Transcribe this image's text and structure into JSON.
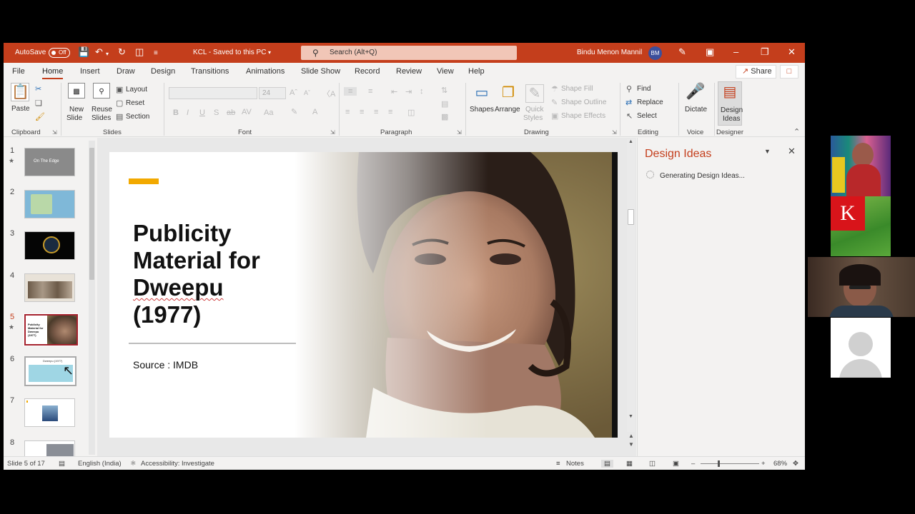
{
  "titlebar": {
    "autosave_label": "AutoSave",
    "autosave_state": "Off",
    "doc_title": "KCL  -  Saved to this PC",
    "search_placeholder": "Search (Alt+Q)",
    "user_name": "Bindu Menon Mannil",
    "user_initials": "BM"
  },
  "tabs": [
    "File",
    "Home",
    "Insert",
    "Draw",
    "Design",
    "Transitions",
    "Animations",
    "Slide Show",
    "Record",
    "Review",
    "View",
    "Help"
  ],
  "active_tab": "Home",
  "share_label": "Share",
  "ribbon": {
    "clipboard": {
      "label": "Clipboard",
      "paste": "Paste"
    },
    "slides": {
      "label": "Slides",
      "new_slide_1": "New",
      "new_slide_2": "Slide",
      "reuse_1": "Reuse",
      "reuse_2": "Slides",
      "layout": "Layout",
      "reset": "Reset",
      "section": "Section"
    },
    "font": {
      "label": "Font",
      "font_size": "24"
    },
    "paragraph": {
      "label": "Paragraph"
    },
    "drawing": {
      "label": "Drawing",
      "shapes": "Shapes",
      "arrange": "Arrange",
      "quick_1": "Quick",
      "quick_2": "Styles",
      "shape_fill": "Shape Fill",
      "shape_outline": "Shape Outline",
      "shape_effects": "Shape Effects"
    },
    "editing": {
      "label": "Editing",
      "find": "Find",
      "replace": "Replace",
      "select": "Select"
    },
    "voice": {
      "label": "Voice",
      "dictate": "Dictate"
    },
    "designer": {
      "label": "Designer",
      "ideas_1": "Design",
      "ideas_2": "Ideas"
    }
  },
  "thumbnails": [
    {
      "num": "1",
      "star": true,
      "caption": "On The Edge"
    },
    {
      "num": "2",
      "star": false,
      "caption": ""
    },
    {
      "num": "3",
      "star": false,
      "caption": ""
    },
    {
      "num": "4",
      "star": false,
      "caption": ""
    },
    {
      "num": "5",
      "star": true,
      "caption": "Publicity Material for Dweepu (1977)"
    },
    {
      "num": "6",
      "star": false,
      "caption": "Dweepu (1977)"
    },
    {
      "num": "7",
      "star": false,
      "caption": ""
    },
    {
      "num": "8",
      "star": false,
      "caption": ""
    }
  ],
  "slide": {
    "title_line1": "Publicity",
    "title_line2": "Material for",
    "title_line3": "Dweepu",
    "title_line4": "(1977)",
    "source": "Source : IMDB"
  },
  "design_pane": {
    "title": "Design Ideas",
    "status": "Generating Design Ideas..."
  },
  "statusbar": {
    "slide_counter": "Slide 5 of 17",
    "language": "English (India)",
    "accessibility": "Accessibility: Investigate",
    "notes": "Notes",
    "zoom": "68%"
  },
  "video_tiles": {
    "k_letter": "K"
  },
  "colors": {
    "accent": "#c43e1c",
    "slide_accent_bar": "#f2a900",
    "active_thumb_border": "#a5222d"
  }
}
